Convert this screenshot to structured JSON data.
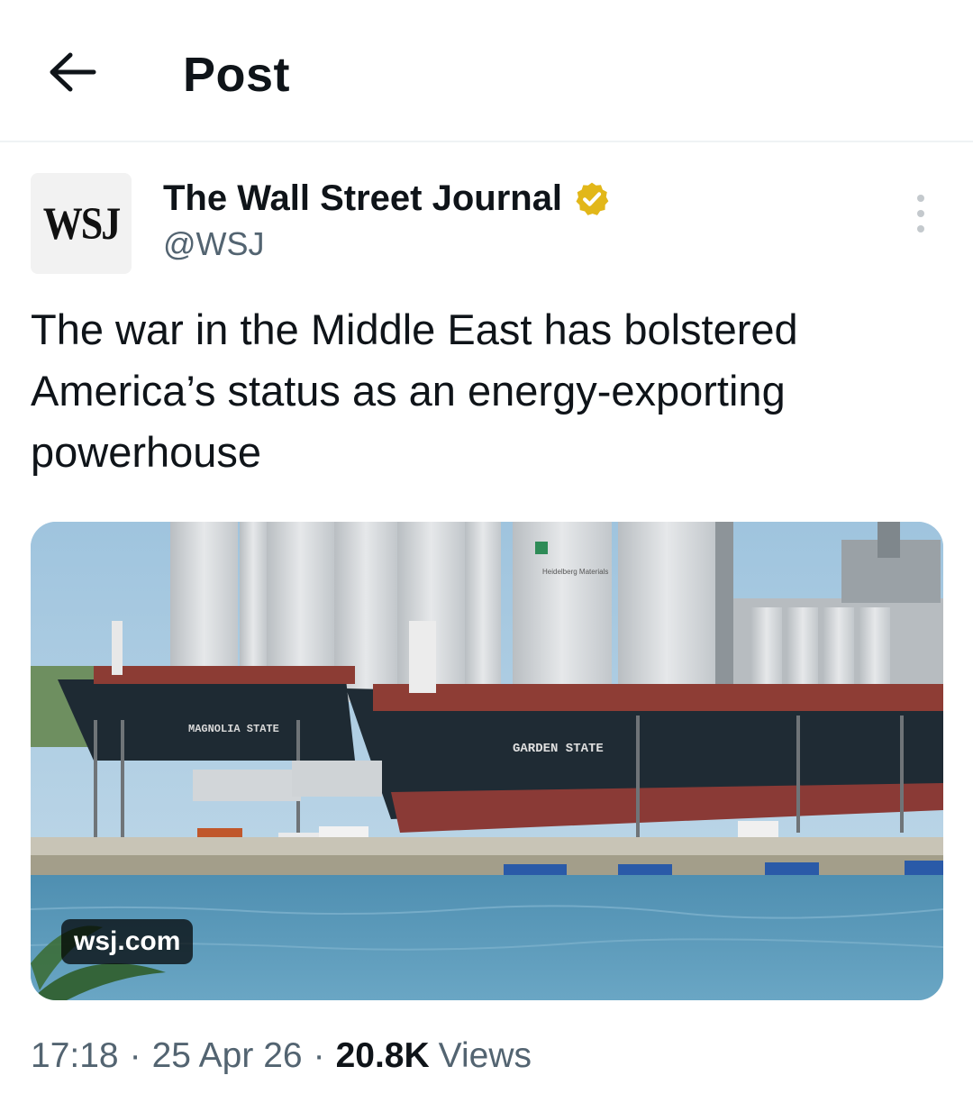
{
  "header": {
    "title": "Post"
  },
  "tweet": {
    "author": {
      "avatar_text": "WSJ",
      "display_name": "The Wall Street Journal",
      "handle": "@WSJ",
      "verified_color": "#e2b719"
    },
    "text": "The war in the Middle East has bolstered America’s status as an energy-exporting powerhouse",
    "media": {
      "link_badge": "wsj.com",
      "ship_label_left": "MAGNOLIA STATE",
      "ship_label_right": "GARDEN STATE",
      "silo_brand": "Heidelberg Materials"
    },
    "meta": {
      "time": "17:18",
      "date": "25 Apr 26",
      "views_count": "20.8K",
      "views_label": "Views"
    }
  },
  "colors": {
    "text_primary": "#0f1419",
    "text_secondary": "#536471",
    "divider": "#eff3f4"
  },
  "icons": [
    "arrow-left-icon",
    "verified-badge-icon",
    "more-vertical-icon"
  ]
}
